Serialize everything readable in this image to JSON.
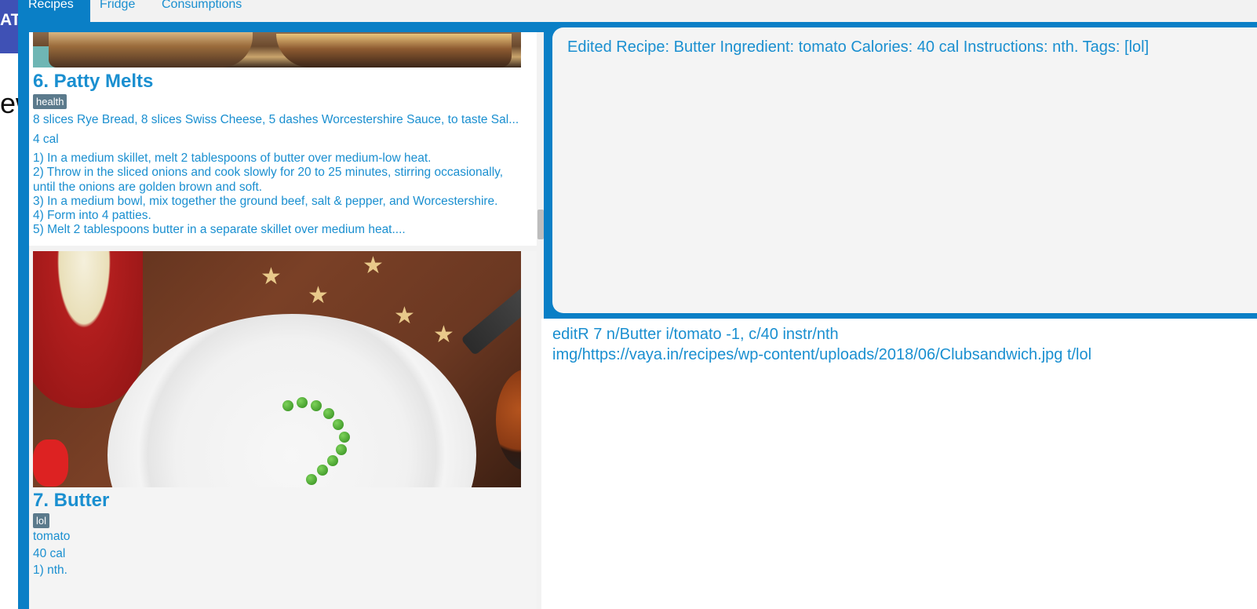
{
  "background_app": {
    "header_fragment": "AT",
    "text_fragment": "ew"
  },
  "tabs": [
    {
      "label": "Recipes",
      "active": true
    },
    {
      "label": "Fridge",
      "active": false
    },
    {
      "label": "Consumptions",
      "active": false
    }
  ],
  "recipes": [
    {
      "title": "6.  Patty Melts",
      "tag": "health",
      "ingredients": "8 slices Rye Bread, 8 slices Swiss Cheese, 5 dashes Worcestershire Sauce, to taste Sal...",
      "calories": "4 cal",
      "instructions": "1) In a medium skillet, melt 2 tablespoons of butter over medium-low heat.\n2) Throw in the sliced onions and cook slowly for 20 to 25 minutes, stirring occasionally, until the onions are golden brown and soft.\n3) In a medium bowl, mix together the ground beef, salt & pepper, and Worcestershire.\n4) Form into 4 patties.\n5) Melt 2 tablespoons butter in a separate skillet over medium heat...."
    },
    {
      "title": "7.  Butter",
      "tag": "lol",
      "ingredients": " tomato",
      "calories": "40 cal",
      "instructions": "1) nth."
    }
  ],
  "result": {
    "text": "Edited Recipe: Butter Ingredient:  tomato Calories: 40 cal Instructions: nth. Tags: [lol]"
  },
  "command": {
    "text": "editR 7 n/Butter i/tomato -1, c/40 instr/nth\nimg/https://vaya.in/recipes/wp-content/uploads/2018/06/Clubsandwich.jpg t/lol"
  },
  "colors": {
    "accent": "#0a7fc6",
    "text_blue": "#1a8fd0",
    "tag_bg": "#5b7a8c",
    "panel_bg": "#f4f4f4"
  }
}
